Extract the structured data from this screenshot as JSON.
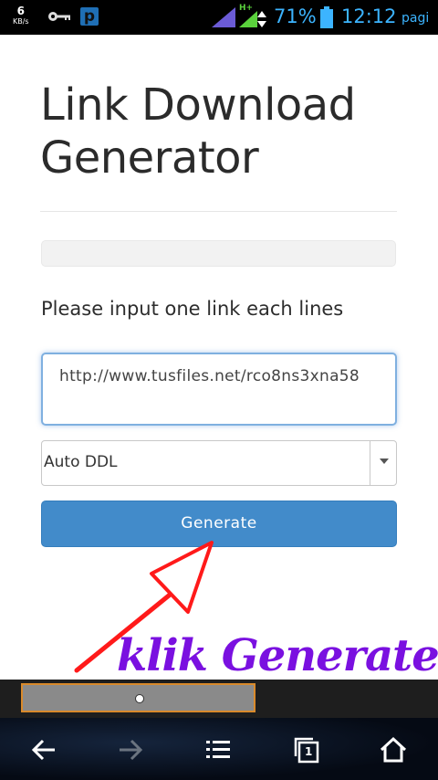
{
  "status_bar": {
    "net_speed_value": "6",
    "net_speed_unit": "KB/s",
    "network_type": "H+",
    "battery_percent": "71%",
    "time": "12:12",
    "period": "pagi",
    "icons": [
      "key-icon",
      "p-app-icon",
      "signal-icon",
      "battery-icon"
    ]
  },
  "page": {
    "title": "Link Download Generator",
    "input_label": "Please input one link each lines",
    "textarea_value": "http://www.tusfiles.net/rco8ns3xna58",
    "select_value": "Auto DDL",
    "generate_label": "Generate"
  },
  "annotation": {
    "text": "klik Generate",
    "color": "#7a10e0",
    "arrow_color": "#ff1a1a"
  },
  "nav": {
    "tab_count": "1",
    "icons": [
      "back-icon",
      "forward-icon",
      "menu-icon",
      "tabs-icon",
      "home-icon"
    ]
  },
  "colors": {
    "status_accent": "#3cb4ff",
    "button_primary": "#428bca"
  }
}
